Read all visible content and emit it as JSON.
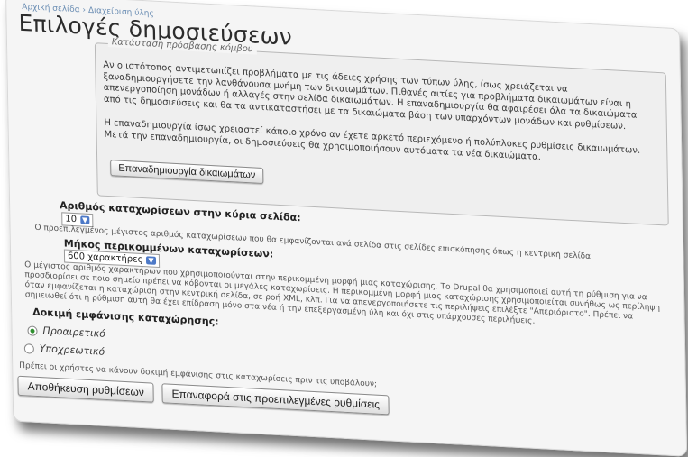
{
  "breadcrumb": "Αρχική σελίδα › Διαχείριση ύλης",
  "page_title": "Επιλογές δημοσιεύσεων",
  "rebuild_section": {
    "legend": "Κατάσταση πρόσβασης κόμβου",
    "paragraph1": "Αν ο ιστότοπος αντιμετωπίζει προβλήματα με τις άδειες χρήσης των τύπων ύλης, ίσως χρειάζεται να ξαναδημιουργήσετε την λανθάνουσα μνήμη των δικαιωμάτων. Πιθανές αιτίες για προβλήματα δικαιωμάτων είναι η απενεργοποίηση μονάδων ή αλλαγές στην σελίδα δικαιωμάτων. Η επαναδημιουργία θα αφαιρέσει όλα τα δικαιώματα από τις δημοσιεύσεις και θα τα αντικαταστήσει με τα δικαιώματα βάση των υπαρχόντων μονάδων και ρυθμίσεων.",
    "paragraph2": "Η επαναδημιουργία ίσως χρειαστεί κάποιο χρόνο αν έχετε αρκετό περιεχόμενο ή πολύπλοκες ρυθμίσεις δικαιωμάτων. Μετά την επαναδημιουργία, οι δημοσιεύσεις θα χρησιμοποιήσουν αυτόματα τα νέα δικαιώματα.",
    "button_label": "Επαναδημιουργία δικαιωμάτων"
  },
  "posts_per_page": {
    "label": "Αριθμός καταχωρίσεων στην κύρια σελίδα:",
    "selected": "10",
    "description": "Ο προεπιλεγμένος μέγιστος αριθμός καταχωρίσεων που θα εμφανίζονται ανά σελίδα στις σελίδες επισκόπησης όπως η κεντρική σελίδα."
  },
  "trim_length": {
    "label": "Μήκος περικομμένων καταχωρίσεων:",
    "selected": "600 χαρακτήρες",
    "description": "Ο μέγιστος αριθμός χαρακτήρων που χρησιμοποιούνται στην περικομμένη μορφή μιας καταχώρισης. Το Drupal θα χρησιμοποιεί αυτή τη ρύθμιση για να προσδιορίσει σε ποιο σημείο πρέπει να κόβονται οι μεγάλες καταχωρίσεις. Η περικομμένη μορφή μιας καταχώρισης χρησιμοποιείται συνήθως ως περίληψη όταν εμφανίζεται η καταχώριση στην κεντρική σελίδα, σε ροή XML, κλπ. Για να απενεργοποιήσετε τις περιλήψεις επιλέξτε \"Απεριόριστο\". Πρέπει να σημειωθεί ότι η ρύθμιση αυτή θα έχει επίδραση μόνο στα νέα ή την επεξεργασμένη ύλη και όχι στις υπάρχουσες περιλήψεις."
  },
  "preview": {
    "label": "Δοκιμή εμφάνισης καταχώρησης:",
    "options": [
      {
        "label": "Προαιρετικό",
        "selected": true
      },
      {
        "label": "Υποχρεωτικό",
        "selected": false
      }
    ],
    "description": "Πρέπει οι χρήστες να κάνουν δοκιμή εμφάνισης στις καταχωρίσεις πριν τις υποβάλουν;"
  },
  "buttons": {
    "save": "Αποθήκευση ρυθμίσεων",
    "reset": "Επαναφορά στις προεπιλεγμένες ρυθμίσεις"
  },
  "colors": {
    "radio_selected": "#2f8f2f",
    "select_arrow": "#4d79c7",
    "breadcrumb": "#6a8db3"
  }
}
